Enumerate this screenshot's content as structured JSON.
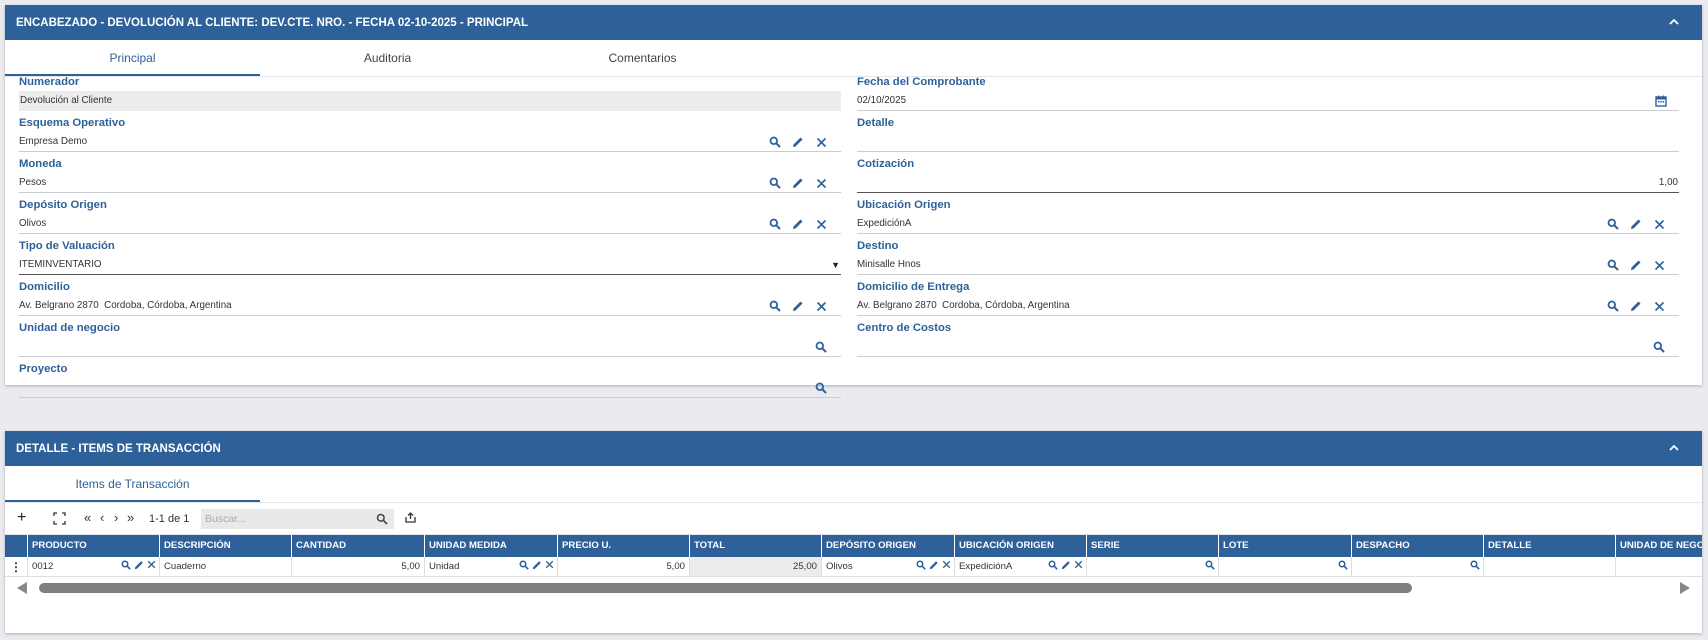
{
  "header_panel": {
    "title": "ENCABEZADO - DEVOLUCIÓN AL CLIENTE: DEV.CTE. NRO. - FECHA 02-10-2025 - PRINCIPAL",
    "tabs": [
      "Principal",
      "Auditoria",
      "Comentarios"
    ],
    "fields": {
      "numerador": {
        "label": "Numerador",
        "value": "Devolución al Cliente"
      },
      "fecha": {
        "label": "Fecha del Comprobante",
        "value": "02/10/2025"
      },
      "esquema": {
        "label": "Esquema Operativo",
        "value": "Empresa Demo"
      },
      "detalle": {
        "label": "Detalle",
        "value": ""
      },
      "moneda": {
        "label": "Moneda",
        "value": "Pesos"
      },
      "cotizacion": {
        "label": "Cotización",
        "value": "1,00"
      },
      "deposito": {
        "label": "Depósito Origen",
        "value": "Olivos"
      },
      "ubicacion": {
        "label": "Ubicación Origen",
        "value": "ExpediciónA"
      },
      "valuacion": {
        "label": "Tipo de Valuación",
        "value": "ITEMINVENTARIO"
      },
      "destino": {
        "label": "Destino",
        "value": "Minisalle Hnos"
      },
      "domicilio": {
        "label": "Domicilio",
        "value": "Av. Belgrano 2870  Cordoba, Córdoba, Argentina"
      },
      "domicilio_entrega": {
        "label": "Domicilio de Entrega",
        "value": "Av. Belgrano 2870  Cordoba, Córdoba, Argentina"
      },
      "unidad_negocio": {
        "label": "Unidad de negocio",
        "value": ""
      },
      "centro_costos": {
        "label": "Centro de Costos",
        "value": ""
      },
      "proyecto": {
        "label": "Proyecto",
        "value": ""
      }
    }
  },
  "detail_panel": {
    "title": "DETALLE - ITEMS DE TRANSACCIÓN",
    "tab": "Items de Transacción",
    "toolbar": {
      "pagination": "1-1 de 1",
      "search_placeholder": "Buscar..."
    },
    "columns": [
      "PRODUCTO",
      "DESCRIPCIÓN",
      "CANTIDAD",
      "UNIDAD MEDIDA",
      "PRECIO U.",
      "TOTAL",
      "DEPÓSITO ORIGEN",
      "UBICACIÓN ORIGEN",
      "SERIE",
      "LOTE",
      "DESPACHO",
      "DETALLE",
      "UNIDAD DE NEGO"
    ],
    "row": {
      "producto": "0012",
      "descripcion": "Cuaderno",
      "cantidad": "5,00",
      "unidad": "Unidad",
      "precio": "5,00",
      "total": "25,00",
      "deposito": "Olivos",
      "ubicacion": "ExpediciónA"
    }
  },
  "colors": {
    "brand": "#2e6199",
    "icon": "#2e6199"
  }
}
